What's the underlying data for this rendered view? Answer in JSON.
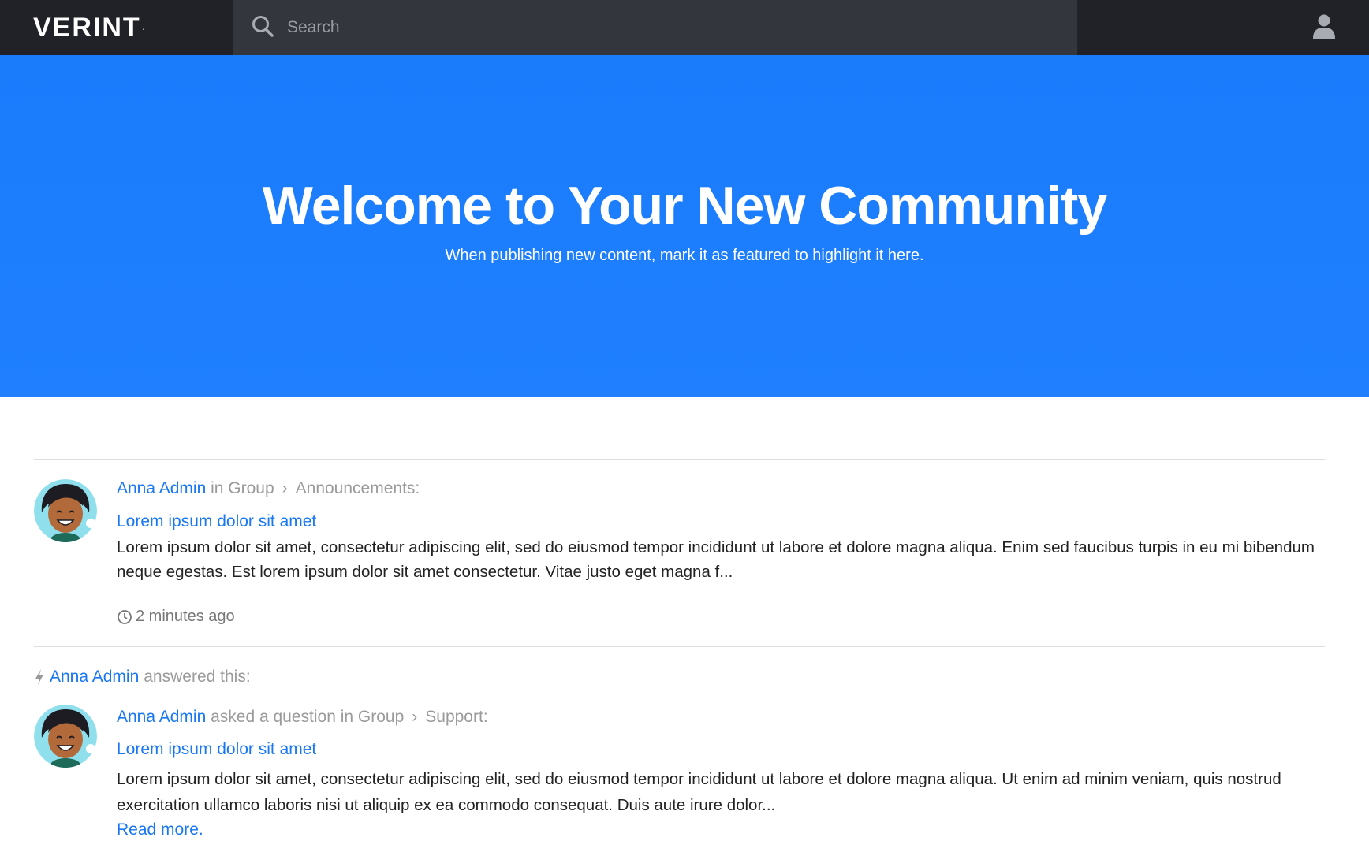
{
  "header": {
    "logo_text": "VERINT",
    "search_placeholder": "Search",
    "user_icon": "user-icon"
  },
  "hero": {
    "title": "Welcome to Your New Community",
    "subtitle": "When publishing new content, mark it as featured to highlight it here.",
    "background_color": "#1a7cfb"
  },
  "activity": [
    {
      "author": "Anna Admin",
      "context_text": "in Group",
      "group": "Announcements:",
      "title": "Lorem ipsum dolor sit amet",
      "body": "Lorem ipsum dolor sit amet, consectetur adipiscing elit, sed do eiusmod tempor incididunt ut labore et dolore magna aliqua. Enim sed faucibus turpis in eu mi bibendum neque egestas. Est lorem ipsum dolor sit amet consectetur. Vitae justo eget magna f...",
      "time": "2 minutes ago"
    },
    {
      "answered_by": "Anna Admin",
      "answered_text": "answered this:",
      "author": "Anna Admin",
      "context_text": "asked a question in Group",
      "group": "Support:",
      "title": "Lorem ipsum dolor sit amet",
      "body": "Lorem ipsum dolor sit amet, consectetur adipiscing elit, sed do eiusmod tempor incididunt ut labore et dolore magna aliqua. Ut enim ad minim veniam, quis nostrud exercitation ullamco laboris nisi ut aliquip ex ea commodo consequat. Duis aute irure dolor...",
      "read_more": "Read more."
    }
  ],
  "colors": {
    "link": "#1877f2",
    "navbar": "#202227",
    "search_bg": "#33363d"
  }
}
